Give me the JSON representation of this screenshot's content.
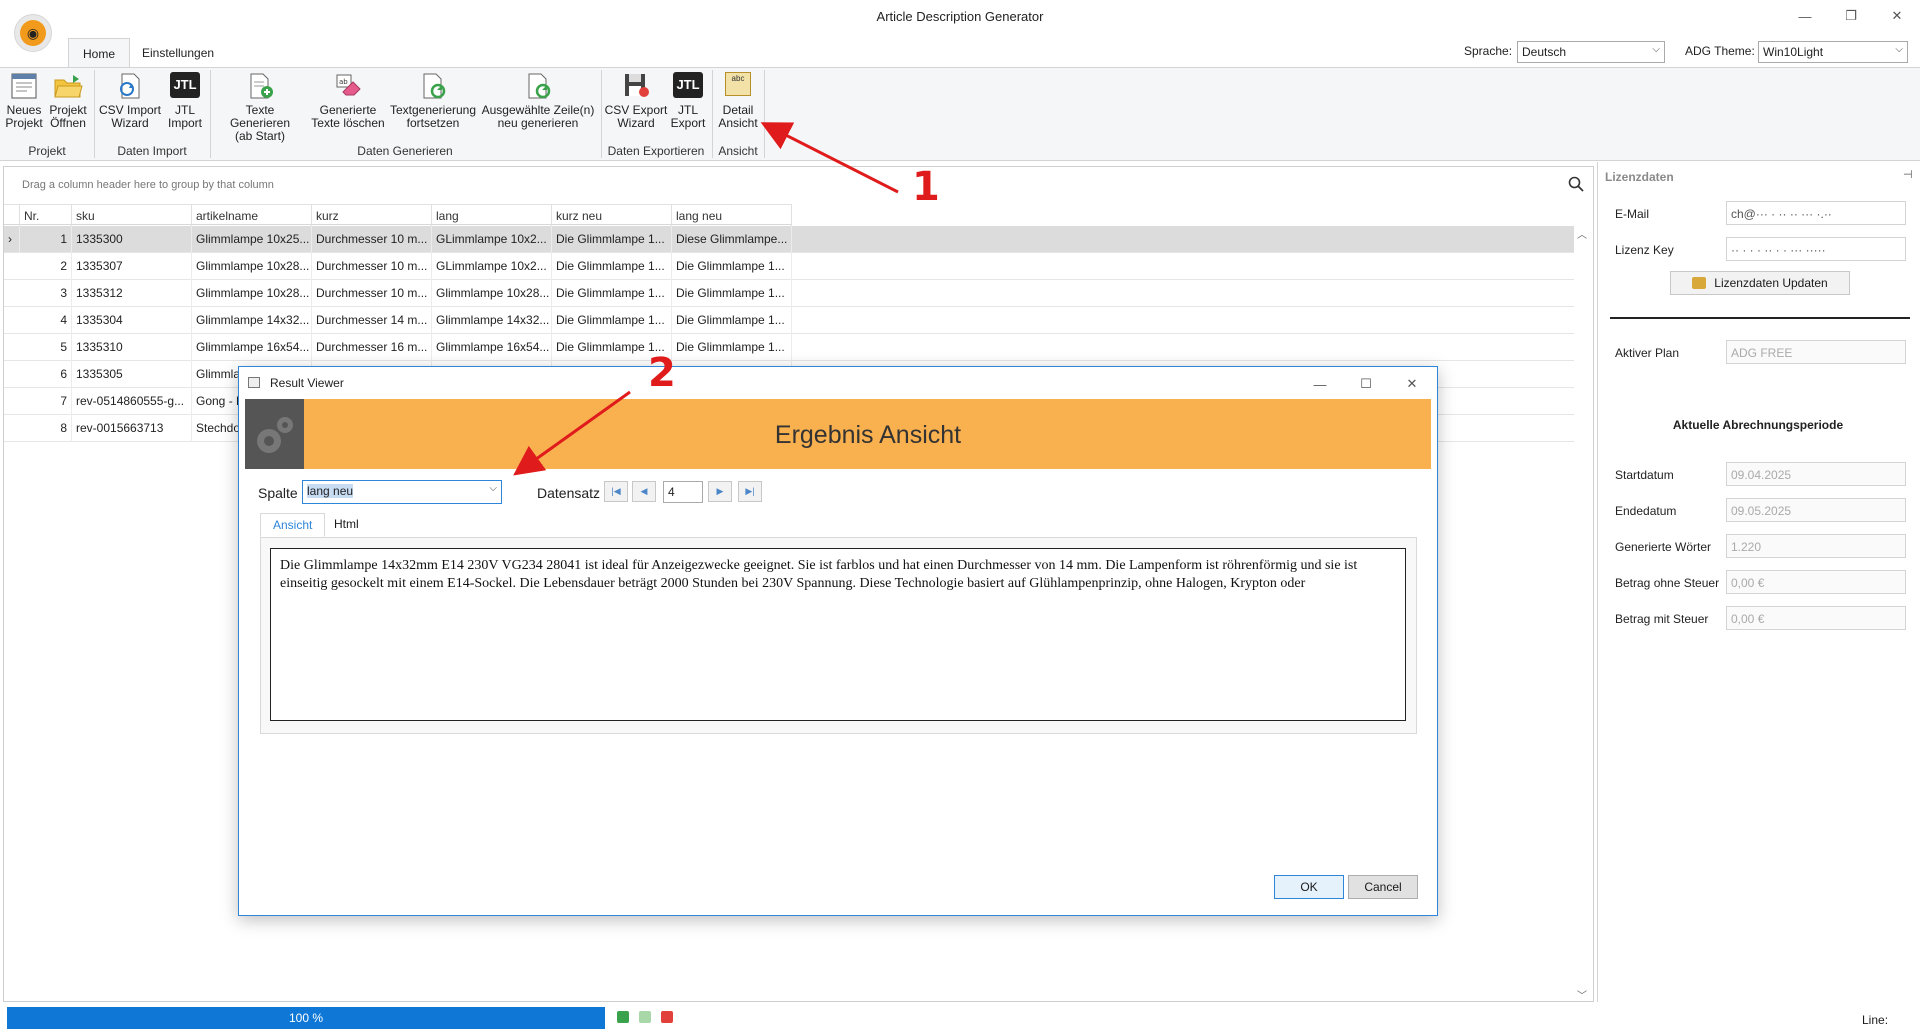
{
  "window": {
    "title": "Article Description Generator",
    "min_glyph": "—",
    "restore_glyph": "❐",
    "close_glyph": "✕"
  },
  "ribbon_tabs": [
    "Home",
    "Einstellungen"
  ],
  "top_controls": {
    "sprache_label": "Sprache:",
    "sprache_value": "Deutsch",
    "theme_label": "ADG Theme:",
    "theme_value": "Win10Light"
  },
  "ribbon": {
    "buttons": [
      {
        "line1": "Neues",
        "line2": "Projekt"
      },
      {
        "line1": "Projekt",
        "line2": "Öffnen"
      },
      {
        "line1": "CSV Import",
        "line2": "Wizard"
      },
      {
        "line1": "JTL",
        "line2": "Import"
      },
      {
        "line1": "Texte Generieren",
        "line2": "(ab Start)"
      },
      {
        "line1": "Generierte",
        "line2": "Texte löschen"
      },
      {
        "line1": "Textgenerierung",
        "line2": "fortsetzen"
      },
      {
        "line1": "Ausgewählte Zeile(n)",
        "line2": "neu generieren"
      },
      {
        "line1": "CSV Export",
        "line2": "Wizard"
      },
      {
        "line1": "JTL",
        "line2": "Export"
      },
      {
        "line1": "Detail",
        "line2": "Ansicht"
      }
    ],
    "groups": [
      "Projekt",
      "Daten Import",
      "Daten Generieren",
      "Daten Exportieren",
      "Ansicht"
    ],
    "jtl_logo_text": "JTL",
    "abc_logo_text": "abc"
  },
  "grid": {
    "group_hint": "Drag a column header here to group by that column",
    "columns": [
      "Nr.",
      "sku",
      "artikelname",
      "kurz",
      "lang",
      "kurz neu",
      "lang neu"
    ],
    "row_indicator": "›",
    "rows": [
      [
        "1",
        "1335300",
        "Glimmlampe 10x25...",
        "Durchmesser 10 m...",
        "GLimmlampe 10x2...",
        "Die Glimmlampe 1...",
        "Diese Glimmlampe..."
      ],
      [
        "2",
        "1335307",
        "Glimmlampe 10x28...",
        "Durchmesser 10 m...",
        "GLimmlampe 10x2...",
        "Die Glimmlampe 1...",
        "Die Glimmlampe 1..."
      ],
      [
        "3",
        "1335312",
        "Glimmlampe 10x28...",
        "Durchmesser 10 m...",
        "Glimmlampe 10x28...",
        "Die Glimmlampe 1...",
        "Die Glimmlampe 1..."
      ],
      [
        "4",
        "1335304",
        "Glimmlampe 14x32...",
        "Durchmesser 14 m...",
        "Glimmlampe 14x32...",
        "Die Glimmlampe 1...",
        "Die Glimmlampe 1..."
      ],
      [
        "5",
        "1335310",
        "Glimmlampe 16x54...",
        "Durchmesser 16 m...",
        "Glimmlampe 16x54...",
        "Die Glimmlampe 1...",
        "Die Glimmlampe 1..."
      ],
      [
        "6",
        "1335305",
        "Glimmla",
        "",
        "",
        "",
        ""
      ],
      [
        "7",
        "rev-0514860555-g...",
        "Gong - D",
        "",
        "",
        "",
        ""
      ],
      [
        "8",
        "rev-0015663713",
        "Stechdo",
        "",
        "",
        "",
        ""
      ]
    ]
  },
  "license_panel": {
    "title": "Lizenzdaten",
    "pin_glyph": "⊣",
    "email_label": "E-Mail",
    "email_value": "ch@···  ·  ·· ·· ··· ·.··",
    "key_label": "Lizenz Key",
    "key_value": "·· · · ·  ·· · · ··· ·····",
    "update_button": "Lizenzdaten Updaten",
    "plan_label": "Aktiver Plan",
    "plan_value": "ADG FREE",
    "period_title": "Aktuelle Abrechnungsperiode",
    "fields": [
      {
        "label": "Startdatum",
        "value": "09.04.2025"
      },
      {
        "label": "Endedatum",
        "value": "09.05.2025"
      },
      {
        "label": "Generierte Wörter",
        "value": "1.220"
      },
      {
        "label": "Betrag ohne Steuer",
        "value": "0,00 €"
      },
      {
        "label": "Betrag mit Steuer",
        "value": "0,00 €"
      }
    ]
  },
  "dialog": {
    "title": "Result Viewer",
    "banner": "Ergebnis Ansicht",
    "spalte_label": "Spalte",
    "spalte_value": "lang neu",
    "datensatz_label": "Datensatz",
    "datensatz_value": "4",
    "nav": {
      "first": "|◀",
      "prev": "◀",
      "next": "▶",
      "last": "▶|"
    },
    "tabs": [
      "Ansicht",
      "Html"
    ],
    "text": "Die Glimmlampe 14x32mm E14 230V VG234 28041 ist ideal für Anzeigezwecke geeignet. Sie ist farblos und hat einen Durchmesser von 14 mm. Die Lampenform ist röhrenförmig und sie ist einseitig gesockelt mit einem E14-Sockel. Die Lebensdauer beträgt 2000 Stunden bei 230V Spannung. Diese Technologie basiert auf Glühlampenprinzip, ohne Halogen, Krypton oder",
    "ok": "OK",
    "cancel": "Cancel"
  },
  "status": {
    "progress_text": "100 %",
    "progress_fraction": 1.0,
    "line_label": "Line:"
  },
  "annotations": [
    "1",
    "2"
  ],
  "colors": {
    "accent": "#0f78d7",
    "banner": "#f9b04f",
    "annotation": "#e01b1b"
  }
}
